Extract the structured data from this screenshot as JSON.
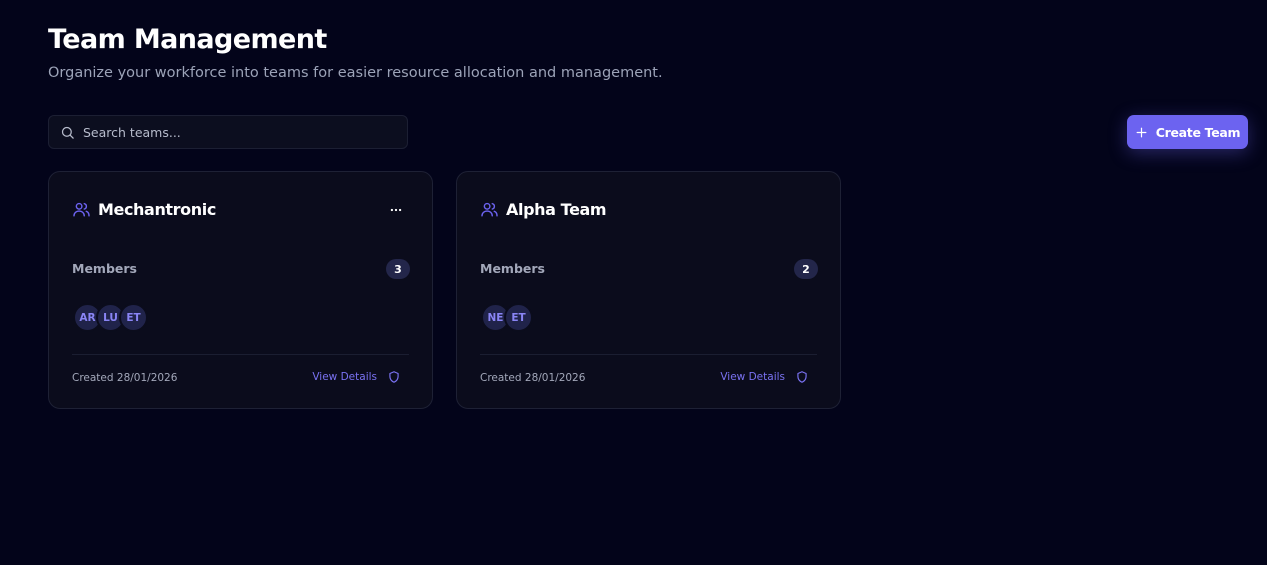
{
  "header": {
    "title": "Team Management",
    "subtitle": "Organize your workforce into teams for easier resource allocation and management."
  },
  "search": {
    "placeholder": "Search teams...",
    "value": "",
    "icon": "search-icon"
  },
  "actions": {
    "create_label": "Create Team",
    "create_icon": "plus-icon"
  },
  "colors": {
    "accent": "#6c63f0",
    "background": "#03041a",
    "card": "#0b0c1c"
  },
  "teams": [
    {
      "name": "Mechantronic",
      "icon": "users-icon",
      "members_label": "Members",
      "member_count": "3",
      "avatars": [
        "AR",
        "LU",
        "ET"
      ],
      "created": "Created 28/01/2026",
      "view_label": "View Details",
      "view_icon": "shield-icon",
      "has_menu": true
    },
    {
      "name": "Alpha Team",
      "icon": "users-icon",
      "members_label": "Members",
      "member_count": "2",
      "avatars": [
        "NE",
        "ET"
      ],
      "created": "Created 28/01/2026",
      "view_label": "View Details",
      "view_icon": "shield-icon",
      "has_menu": false
    }
  ]
}
